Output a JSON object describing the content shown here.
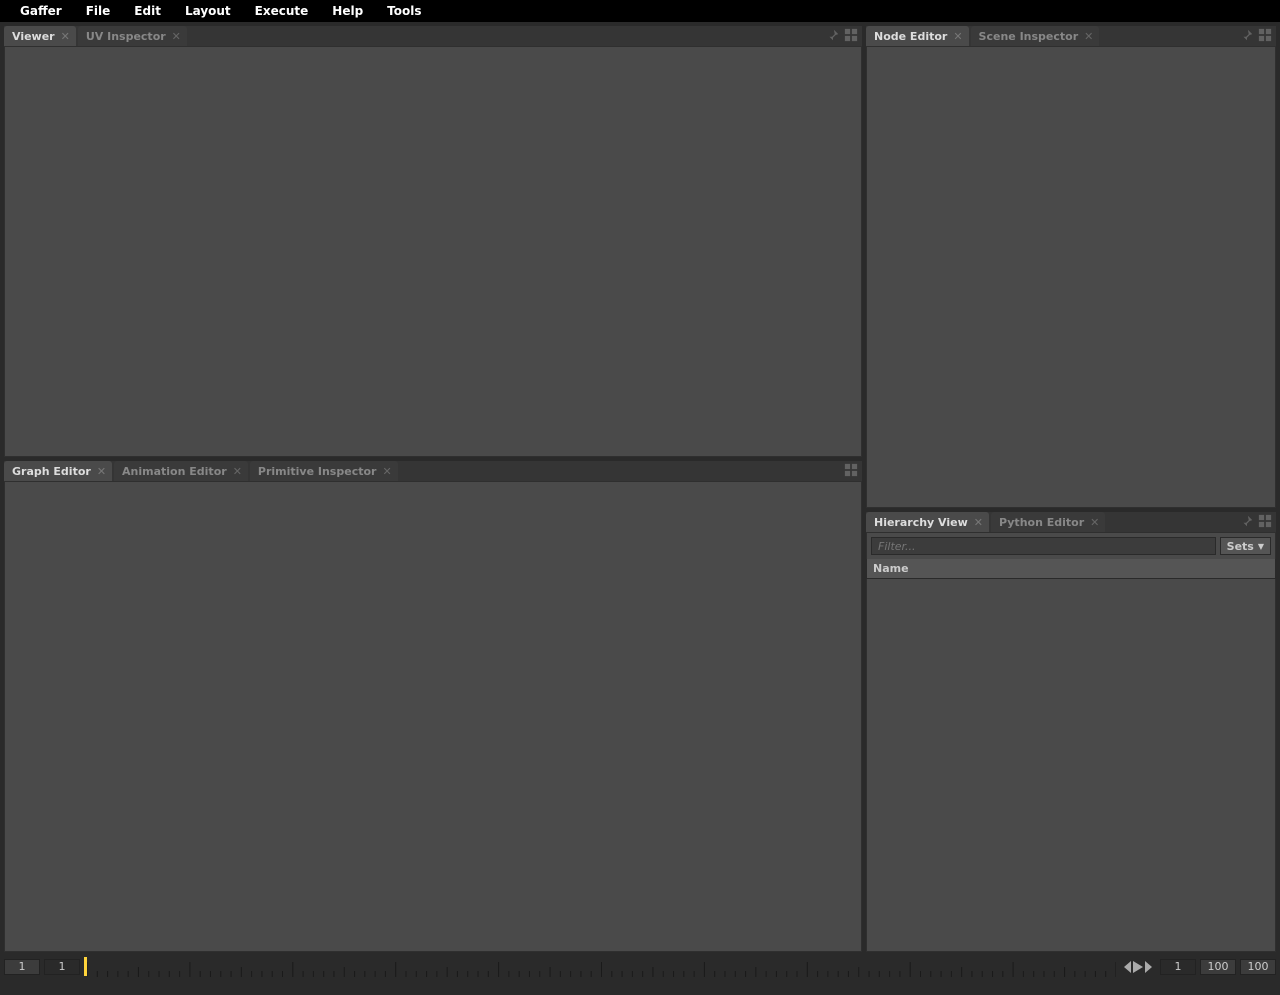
{
  "menu": {
    "items": [
      "Gaffer",
      "File",
      "Edit",
      "Layout",
      "Execute",
      "Help",
      "Tools"
    ]
  },
  "panels": {
    "viewer": {
      "tabs": [
        {
          "label": "Viewer",
          "active": true
        },
        {
          "label": "UV Inspector",
          "active": false
        }
      ]
    },
    "graph": {
      "tabs": [
        {
          "label": "Graph Editor",
          "active": true
        },
        {
          "label": "Animation Editor",
          "active": false
        },
        {
          "label": "Primitive Inspector",
          "active": false
        }
      ]
    },
    "nodeEditor": {
      "tabs": [
        {
          "label": "Node Editor",
          "active": true
        },
        {
          "label": "Scene Inspector",
          "active": false
        }
      ]
    },
    "hierarchy": {
      "tabs": [
        {
          "label": "Hierarchy View",
          "active": true
        },
        {
          "label": "Python Editor",
          "active": false
        }
      ],
      "filterPlaceholder": "Filter...",
      "setsLabel": "Sets",
      "columnHeader": "Name"
    }
  },
  "timeline": {
    "startBound": "1",
    "start": "1",
    "end": "100",
    "endBound": "100",
    "current": "1"
  }
}
